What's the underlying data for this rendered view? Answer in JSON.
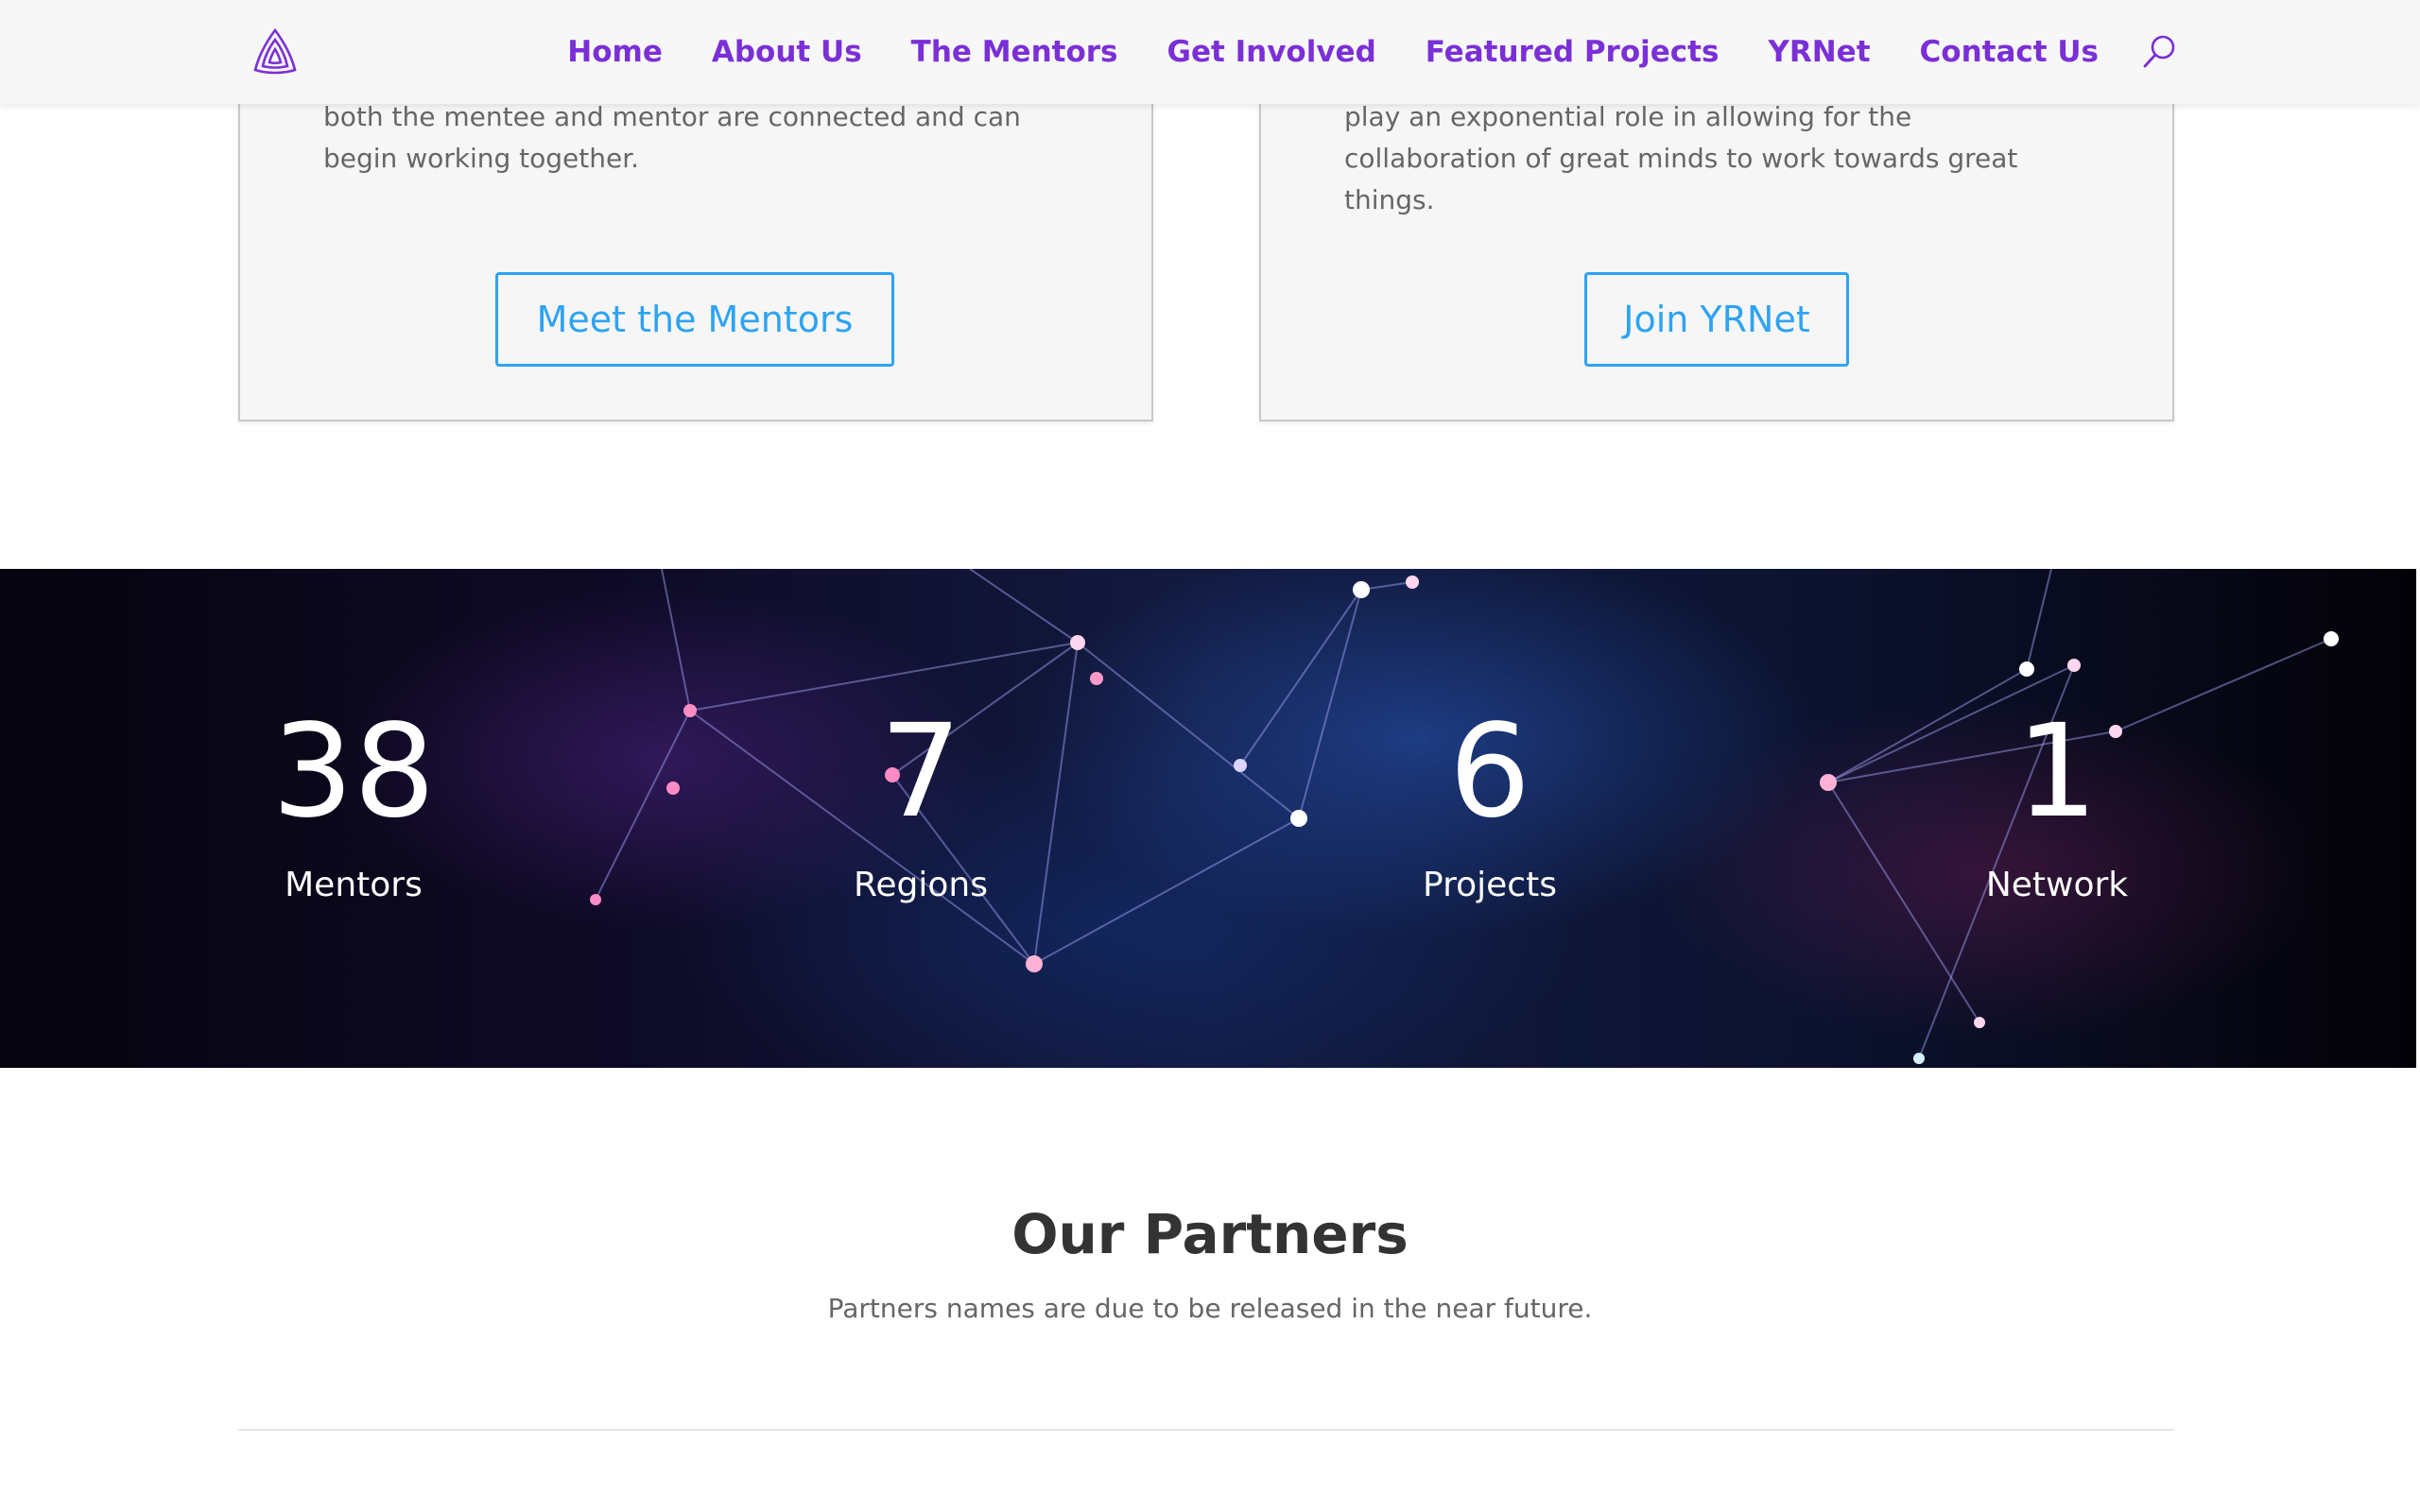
{
  "header": {
    "logo_icon": "triskele-logo-icon",
    "nav": [
      {
        "label": "Home"
      },
      {
        "label": "About Us"
      },
      {
        "label": "The Mentors"
      },
      {
        "label": "Get Involved"
      },
      {
        "label": "Featured Projects"
      },
      {
        "label": "YRNet"
      },
      {
        "label": "Contact Us"
      }
    ],
    "search_icon": "search-icon",
    "nav_color": "#7b2fd6"
  },
  "cards": {
    "left": {
      "text": "both the mentee and mentor are connected and can begin working together.",
      "button": "Meet the Mentors"
    },
    "right": {
      "text": "play an exponential role in allowing for the collaboration of great minds to work towards great things.",
      "button": "Join YRNet"
    },
    "button_color": "#2ea3f2"
  },
  "stats": [
    {
      "number": "38",
      "label": "Mentors"
    },
    {
      "number": "7",
      "label": "Regions"
    },
    {
      "number": "6",
      "label": "Projects"
    },
    {
      "number": "1",
      "label": "Network"
    }
  ],
  "partners": {
    "title": "Our Partners",
    "subtitle": "Partners names are due to be released in the near future."
  }
}
